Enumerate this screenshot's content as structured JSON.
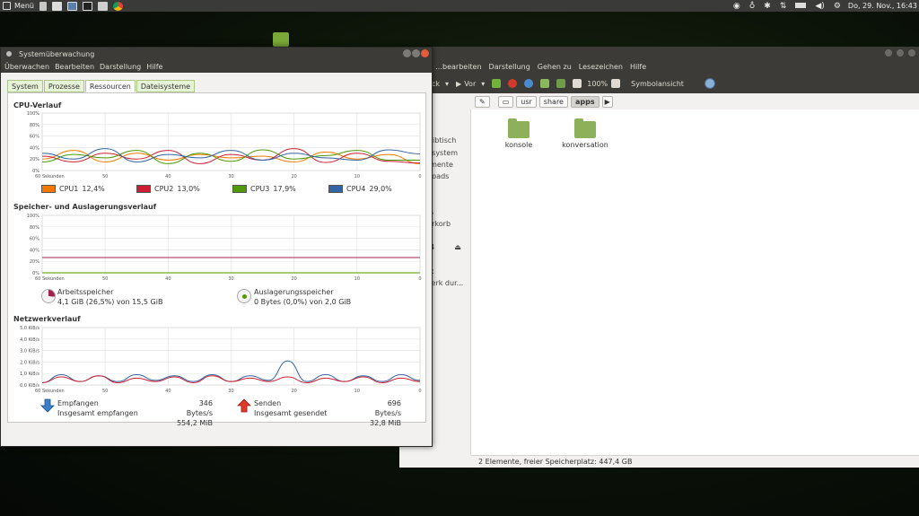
{
  "panel": {
    "menu_label": "Menü",
    "datetime": "Do, 29. Nov., 16:43",
    "icons": [
      "steam-icon",
      "bulb-icon",
      "bluetooth-icon",
      "network-arrows-icon",
      "battery-icon",
      "volume-icon",
      "gear-icon"
    ]
  },
  "fm": {
    "menus": [
      "…bearbeiten",
      "Darstellung",
      "Gehen zu",
      "Lesezeichen",
      "Hilfe"
    ],
    "toolbar": {
      "back": "ck",
      "forward": "Vor",
      "zoom": "100%",
      "view": "Symbolansicht"
    },
    "path": [
      "usr",
      "share",
      "apps"
    ],
    "sidebar": [
      "r",
      "pl",
      "reibtisch",
      "eisystem",
      "umente",
      "nloads",
      "k",
      "r",
      "os",
      "lerkorb",
      "",
      "64",
      "",
      "rk",
      "werk dur..."
    ],
    "folders": [
      {
        "name": "konsole"
      },
      {
        "name": "konversation"
      }
    ],
    "status": "2 Elemente, freier Speicherplatz: 447,4 GB"
  },
  "sm": {
    "title": "Systemüberwachung",
    "menus": [
      "Überwachen",
      "Bearbeiten",
      "Darstellung",
      "Hilfe"
    ],
    "tabs": [
      "System",
      "Prozesse",
      "Ressourcen",
      "Dateisysteme"
    ],
    "active_tab": "Ressourcen",
    "sections": {
      "cpu": "CPU-Verlauf",
      "mem": "Speicher- und Auslagerungsverlauf",
      "net": "Netzwerkverlauf"
    },
    "x_ticks": [
      "60 Sekunden",
      "50",
      "40",
      "30",
      "20",
      "10",
      "0"
    ],
    "cpu_legend": [
      {
        "label": "CPU1",
        "value": "12,4%",
        "color": "#f57900"
      },
      {
        "label": "CPU2",
        "value": "13,0%",
        "color": "#cc1f33"
      },
      {
        "label": "CPU3",
        "value": "17,9%",
        "color": "#4e9a06"
      },
      {
        "label": "CPU4",
        "value": "29,0%",
        "color": "#3465a4"
      }
    ],
    "mem": {
      "ram_label": "Arbeitsspeicher",
      "ram_value": "4,1 GiB (26,5%) von 15,5 GiB",
      "swap_label": "Auslagerungsspeicher",
      "swap_value": "0 Bytes (0,0%) von 2,0 GiB"
    },
    "net": {
      "recv_label": "Empfangen",
      "recv_rate": "346 Bytes/s",
      "recv_total_label": "Insgesamt empfangen",
      "recv_total": "554,2 MiB",
      "send_label": "Senden",
      "send_rate": "696 Bytes/s",
      "send_total_label": "Insgesamt gesendet",
      "send_total": "32,8 MiB"
    }
  },
  "chart_data": [
    {
      "type": "line",
      "title": "CPU-Verlauf",
      "x": [
        60,
        55,
        50,
        45,
        40,
        35,
        30,
        25,
        20,
        15,
        10,
        5,
        0
      ],
      "y_ticks": [
        "100%",
        "80%",
        "60%",
        "40%",
        "20%",
        "0%"
      ],
      "ylim": [
        0,
        100
      ],
      "series": [
        {
          "name": "CPU1",
          "color": "#f57900",
          "values": [
            20,
            35,
            15,
            30,
            18,
            28,
            22,
            25,
            15,
            32,
            20,
            28,
            12
          ]
        },
        {
          "name": "CPU2",
          "color": "#cc1f33",
          "values": [
            25,
            15,
            30,
            20,
            35,
            12,
            28,
            18,
            38,
            14,
            30,
            16,
            13
          ]
        },
        {
          "name": "CPU3",
          "color": "#4e9a06",
          "values": [
            15,
            28,
            22,
            35,
            12,
            30,
            16,
            36,
            20,
            26,
            35,
            18,
            18
          ]
        },
        {
          "name": "CPU4",
          "color": "#3465a4",
          "values": [
            30,
            20,
            38,
            15,
            28,
            22,
            35,
            18,
            30,
            22,
            18,
            36,
            29
          ]
        }
      ]
    },
    {
      "type": "line",
      "title": "Speicher- und Auslagerungsverlauf",
      "x": [
        60,
        0
      ],
      "y_ticks": [
        "100%",
        "80%",
        "60%",
        "40%",
        "20%",
        "0%"
      ],
      "ylim": [
        0,
        100
      ],
      "series": [
        {
          "name": "Arbeitsspeicher",
          "color": "#a3234f",
          "values": [
            26.5,
            26.5
          ]
        },
        {
          "name": "Auslagerungsspeicher",
          "color": "#4e9a06",
          "values": [
            0,
            0
          ]
        }
      ]
    },
    {
      "type": "line",
      "title": "Netzwerkverlauf",
      "x": [
        60,
        57,
        54,
        51,
        48,
        45,
        42,
        39,
        36,
        33,
        30,
        27,
        24,
        21,
        18,
        15,
        12,
        9,
        6,
        3,
        0
      ],
      "y_ticks": [
        "5,0 KiB/s",
        "4,0 KiB/s",
        "3,0 KiB/s",
        "2,0 KiB/s",
        "1,0 KiB/s",
        "0,0 KiB/s"
      ],
      "ylim": [
        0,
        5
      ],
      "series": [
        {
          "name": "Empfangen",
          "color": "#3465a4",
          "values": [
            0.2,
            0.9,
            0.3,
            0.8,
            0.3,
            0.9,
            0.4,
            0.8,
            0.3,
            0.9,
            0.3,
            0.8,
            0.4,
            2.1,
            0.3,
            0.9,
            0.3,
            0.8,
            0.3,
            0.9,
            0.4
          ]
        },
        {
          "name": "Senden",
          "color": "#cc1f33",
          "values": [
            0.2,
            0.7,
            0.3,
            0.8,
            0.2,
            0.6,
            0.3,
            0.7,
            0.2,
            0.8,
            0.3,
            0.6,
            0.3,
            0.7,
            0.2,
            0.6,
            0.3,
            0.7,
            0.2,
            0.6,
            0.3
          ]
        }
      ]
    }
  ]
}
